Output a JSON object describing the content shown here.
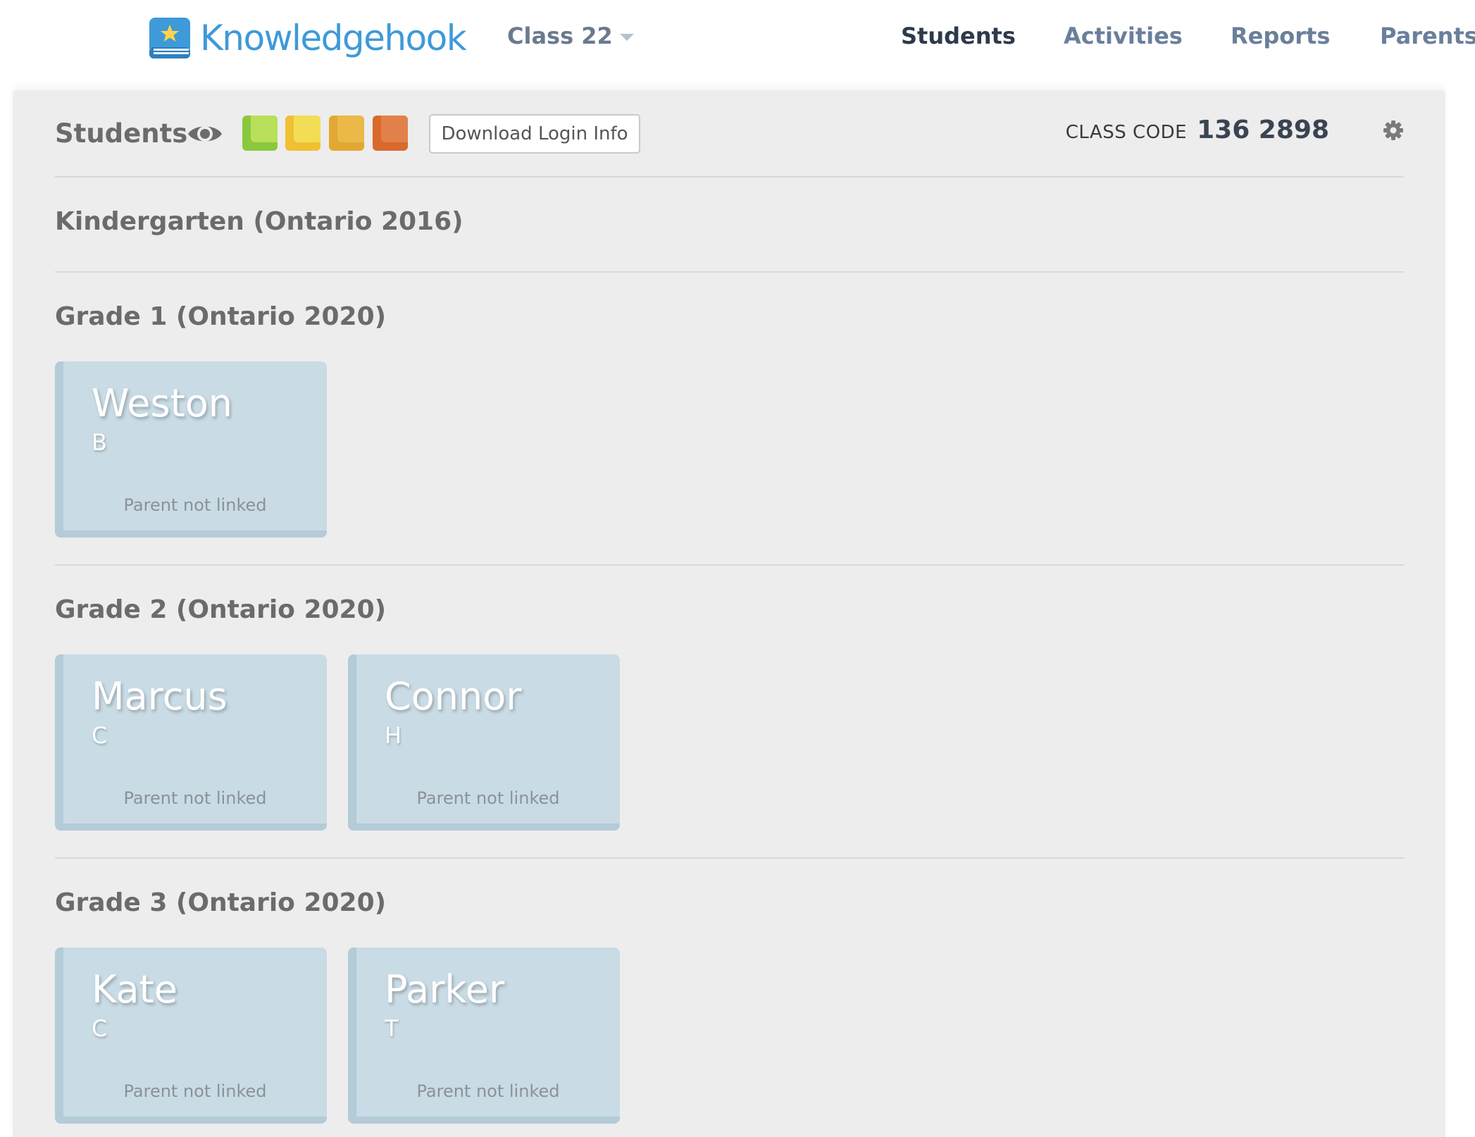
{
  "app": {
    "brand": "Knowledgehook",
    "class_selector": "Class 22"
  },
  "nav": {
    "students": "Students",
    "activities": "Activities",
    "reports": "Reports",
    "parents": "Parents",
    "active": "Students"
  },
  "toolbar": {
    "title": "Students",
    "download_label": "Download Login Info",
    "class_code_label": "CLASS CODE",
    "class_code_value": "136 2898",
    "swatch_colors": [
      "#8bc83c",
      "#f0c033",
      "#e2a834",
      "#d96a2c"
    ]
  },
  "sections": [
    {
      "title": "Kindergarten (Ontario 2016)",
      "students": []
    },
    {
      "title": "Grade 1 (Ontario 2020)",
      "students": [
        {
          "first": "Weston",
          "last": "B",
          "status": "Parent not linked"
        }
      ]
    },
    {
      "title": "Grade 2 (Ontario 2020)",
      "students": [
        {
          "first": "Marcus",
          "last": "C",
          "status": "Parent not linked"
        },
        {
          "first": "Connor",
          "last": "H",
          "status": "Parent not linked"
        }
      ]
    },
    {
      "title": "Grade 3 (Ontario 2020)",
      "students": [
        {
          "first": "Kate",
          "last": "C",
          "status": "Parent not linked"
        },
        {
          "first": "Parker",
          "last": "T",
          "status": "Parent not linked"
        }
      ]
    }
  ]
}
